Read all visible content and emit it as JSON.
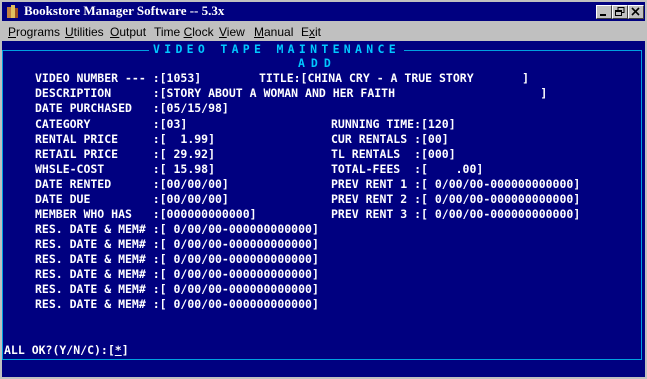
{
  "window": {
    "title": "Bookstore Manager Software -- 5.3x",
    "minimize_icon": "minimize-icon",
    "maximize_icon": "maximize-icon",
    "close_icon": "close-icon"
  },
  "menu": [
    {
      "prefix": "",
      "hot": "P",
      "rest": "rograms"
    },
    {
      "prefix": "",
      "hot": "U",
      "rest": "tilities"
    },
    {
      "prefix": "",
      "hot": "O",
      "rest": "utput"
    },
    {
      "prefix": "Time ",
      "hot": "C",
      "rest": "lock"
    },
    {
      "prefix": "",
      "hot": "V",
      "rest": "iew"
    },
    {
      "prefix": "",
      "hot": "M",
      "rest": "anual"
    },
    {
      "prefix": "E",
      "hot": "x",
      "rest": "it"
    }
  ],
  "screen": {
    "header": "VIDEO TAPE MAINTENANCE",
    "mode": "ADD",
    "fields": {
      "video_number": "VIDEO NUMBER --- :[1053]",
      "title": "TITLE:[CHINA CRY - A TRUE STORY       ]",
      "description": "DESCRIPTION      :[STORY ABOUT A WOMAN AND HER FAITH                     ]",
      "date_purchased": "DATE PURCHASED   :[05/15/98]",
      "category": "CATEGORY         :[03]",
      "running_time": "RUNNING TIME:[120]",
      "rental_price": "RENTAL PRICE     :[  1.99]",
      "cur_rentals": "CUR RENTALS :[00]",
      "retail_price": "RETAIL PRICE     :[ 29.92]",
      "tl_rentals": "TL RENTALS  :[000]",
      "whsle_cost": "WHSLE-COST       :[ 15.98]",
      "total_fees": "TOTAL-FEES  :[    .00]",
      "date_rented": "DATE RENTED      :[00/00/00]",
      "prev_rent_1": "PREV RENT 1 :[ 0/00/00-000000000000]",
      "date_due": "DATE DUE         :[00/00/00]",
      "prev_rent_2": "PREV RENT 2 :[ 0/00/00-000000000000]",
      "member_who_has": "MEMBER WHO HAS   :[000000000000]",
      "prev_rent_3": "PREV RENT 3 :[ 0/00/00-000000000000]",
      "reservations": [
        "RES. DATE & MEM# :[ 0/00/00-000000000000]",
        "RES. DATE & MEM# :[ 0/00/00-000000000000]",
        "RES. DATE & MEM# :[ 0/00/00-000000000000]",
        "RES. DATE & MEM# :[ 0/00/00-000000000000]",
        "RES. DATE & MEM# :[ 0/00/00-000000000000]",
        "RES. DATE & MEM# :[ 0/00/00-000000000000]"
      ]
    },
    "prompt": {
      "label": "ALL OK?(Y/N/C):[",
      "value": "*",
      "close": "]"
    }
  }
}
